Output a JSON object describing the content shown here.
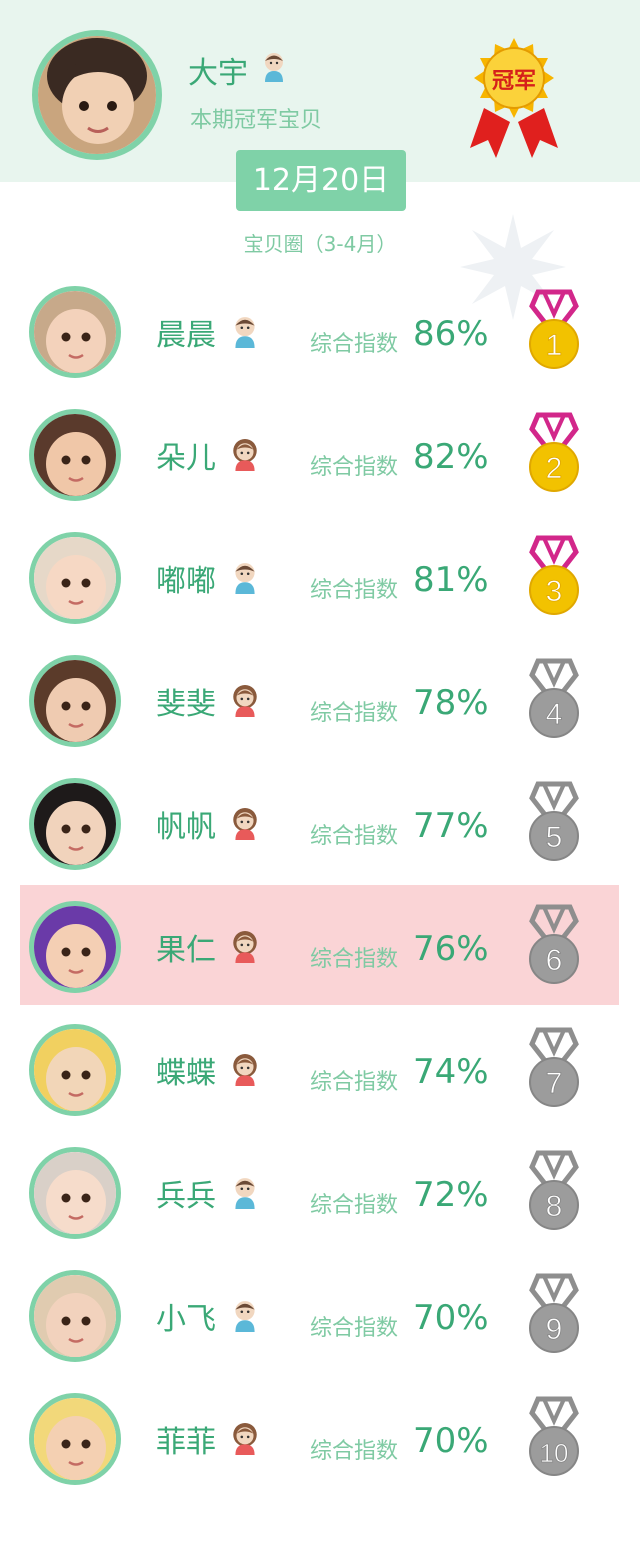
{
  "champion": {
    "name": "大宇",
    "gender": "boy",
    "subtitle": "本期冠军宝贝",
    "trophy_label": "冠军"
  },
  "date": "12月20日",
  "circle": "宝贝圈（3-4月）",
  "score_label": "综合指数",
  "colors": {
    "accent": "#3aa876",
    "accent_light": "#7fd2a8",
    "header_bg": "#e8f5ee",
    "highlight_bg": "#fad4d6",
    "gold": "#f2c200",
    "silver": "#9c9c9c",
    "ribbon": "#d2278a"
  },
  "ranking": [
    {
      "rank": "1",
      "name": "晨晨",
      "gender": "boy",
      "score": "86%",
      "medal": "gold",
      "highlight": false
    },
    {
      "rank": "2",
      "name": "朵儿",
      "gender": "girl",
      "score": "82%",
      "medal": "gold",
      "highlight": false
    },
    {
      "rank": "3",
      "name": "嘟嘟",
      "gender": "boy",
      "score": "81%",
      "medal": "gold",
      "highlight": false
    },
    {
      "rank": "4",
      "name": "斐斐",
      "gender": "girl",
      "score": "78%",
      "medal": "silver",
      "highlight": false
    },
    {
      "rank": "5",
      "name": "帆帆",
      "gender": "girl",
      "score": "77%",
      "medal": "silver",
      "highlight": false
    },
    {
      "rank": "6",
      "name": "果仁",
      "gender": "girl",
      "score": "76%",
      "medal": "silver",
      "highlight": true
    },
    {
      "rank": "7",
      "name": "蝶蝶",
      "gender": "girl",
      "score": "74%",
      "medal": "silver",
      "highlight": false
    },
    {
      "rank": "8",
      "name": "兵兵",
      "gender": "boy",
      "score": "72%",
      "medal": "silver",
      "highlight": false
    },
    {
      "rank": "9",
      "name": "小飞",
      "gender": "boy",
      "score": "70%",
      "medal": "silver",
      "highlight": false
    },
    {
      "rank": "10",
      "name": "菲菲",
      "gender": "girl",
      "score": "70%",
      "medal": "silver",
      "highlight": false
    }
  ]
}
